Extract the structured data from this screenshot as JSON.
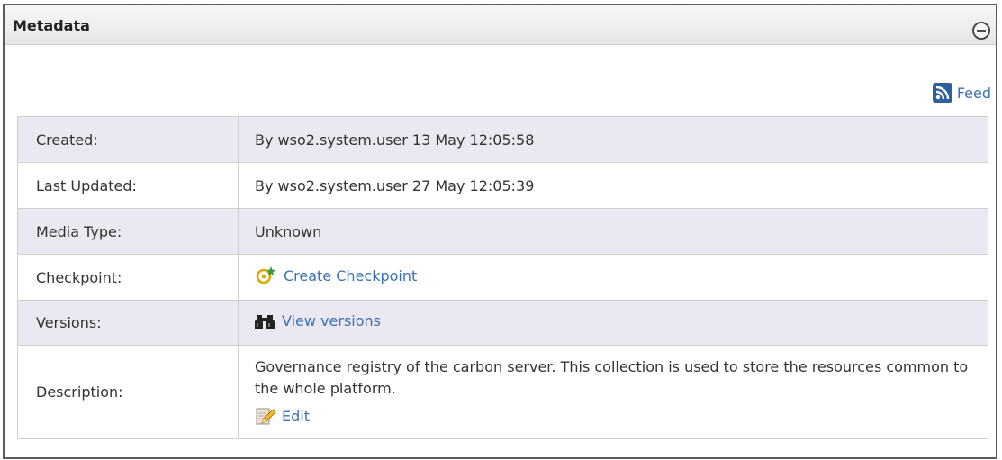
{
  "panel": {
    "title": "Metadata",
    "collapse_icon": "collapse-minus-icon"
  },
  "feed": {
    "label": "Feed",
    "icon": "rss-feed-icon"
  },
  "rows": {
    "created": {
      "label": "Created:",
      "value": "By wso2.system.user 13 May 12:05:58"
    },
    "last_updated": {
      "label": "Last Updated:",
      "value": "By wso2.system.user 27 May 12:05:39"
    },
    "media_type": {
      "label": "Media Type:",
      "value": "Unknown"
    },
    "checkpoint": {
      "label": "Checkpoint:",
      "link": "Create Checkpoint",
      "icon": "checkpoint-icon"
    },
    "versions": {
      "label": "Versions:",
      "link": "View versions",
      "icon": "binoculars-icon"
    },
    "description": {
      "label": "Description:",
      "text": "Governance registry of the carbon server. This collection is used to store the resources common to the whole platform.",
      "edit_label": "Edit",
      "edit_icon": "edit-pencil-icon"
    }
  },
  "colors": {
    "link": "#3a72b3",
    "row_alt": "#ebe8f2",
    "border": "#5b5b5b"
  }
}
